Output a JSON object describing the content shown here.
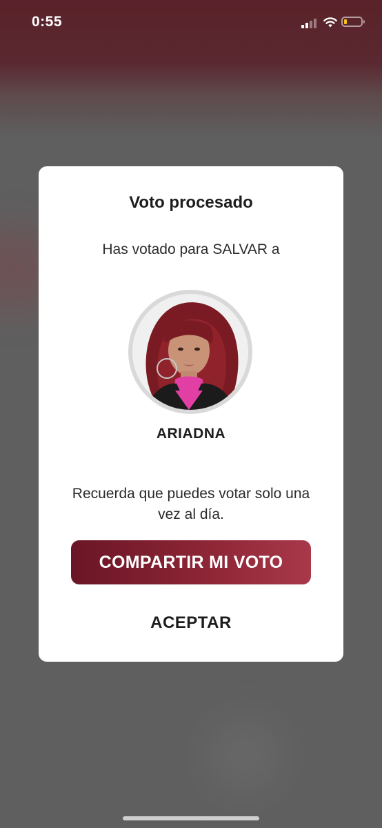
{
  "status_bar": {
    "time": "0:55",
    "battery_color": "#f4c21a",
    "icons": [
      "signal-icon",
      "wifi-icon",
      "battery-icon"
    ]
  },
  "dialog": {
    "title": "Voto procesado",
    "subtitle": "Has votado para SALVAR a",
    "candidate": {
      "name": "ARIADNA",
      "photo": "candidate-photo"
    },
    "reminder": "Recuerda que puedes votar solo una vez al día.",
    "share_label": "COMPARTIR MI VOTO",
    "accept_label": "ACEPTAR"
  },
  "colors": {
    "accent": "#8c2535",
    "dialog_bg": "#ffffff",
    "overlay": "#5f5f5f"
  }
}
